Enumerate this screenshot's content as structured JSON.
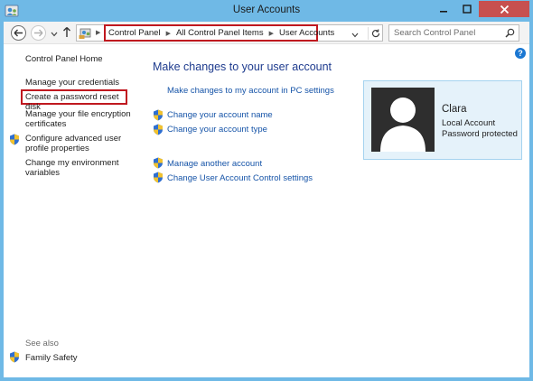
{
  "window": {
    "title": "User Accounts"
  },
  "address": {
    "crumbs": [
      "Control Panel",
      "All Control Panel Items",
      "User Accounts"
    ]
  },
  "search": {
    "placeholder": "Search Control Panel"
  },
  "sidebar": {
    "home": "Control Panel Home",
    "items": [
      {
        "label": "Manage your credentials",
        "shield": false
      },
      {
        "label": "Create a password reset disk",
        "shield": false
      },
      {
        "label": "Manage your file encryption certificates",
        "shield": false
      },
      {
        "label": "Configure advanced user profile properties",
        "shield": true
      },
      {
        "label": "Change my environment variables",
        "shield": false
      }
    ],
    "see_also": "See also",
    "see_also_items": [
      {
        "label": "Family Safety",
        "shield": true
      }
    ]
  },
  "main": {
    "heading": "Make changes to your user account",
    "links": [
      {
        "label": "Make changes to my account in PC settings",
        "shield": false
      },
      {
        "label": "Change your account name",
        "shield": true
      },
      {
        "label": "Change your account type",
        "shield": true
      },
      {
        "label": "Manage another account",
        "shield": true
      },
      {
        "label": "Change User Account Control settings",
        "shield": true
      }
    ]
  },
  "user": {
    "name": "Clara",
    "account_type": "Local Account",
    "protection": "Password protected"
  },
  "colors": {
    "title_bar": "#6fb9e6",
    "close_button": "#c7504f",
    "link": "#1654a8",
    "heading": "#1e3b8e",
    "highlight_box": "#c0181f",
    "user_card": "#e5f2fa"
  },
  "icons": {
    "title": "user-accounts-icon",
    "back": "back-arrow-icon",
    "forward": "forward-arrow-icon",
    "up": "up-arrow-icon",
    "refresh": "refresh-icon",
    "search": "search-icon",
    "help": "help-icon",
    "uac": "uac-shield-icon"
  }
}
